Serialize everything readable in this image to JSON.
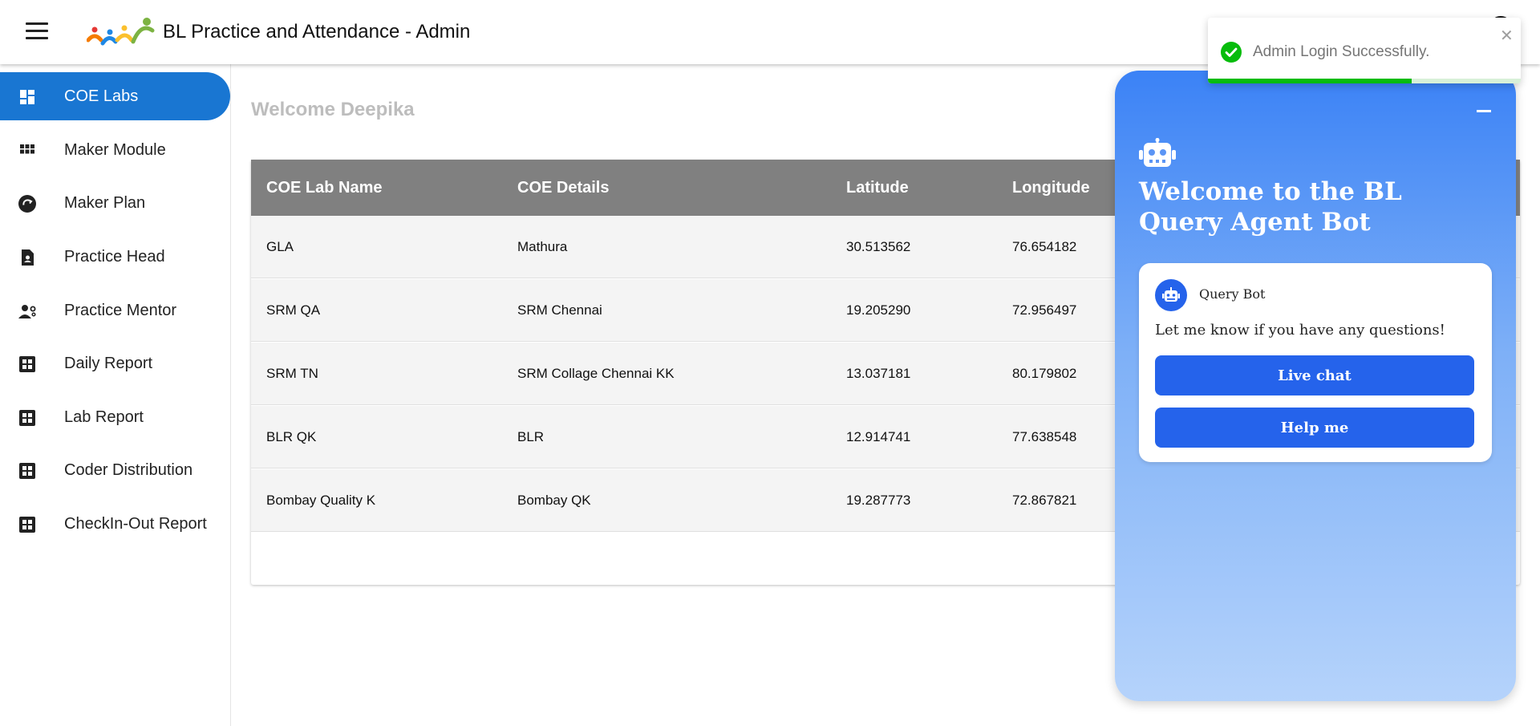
{
  "header": {
    "menu_icon": "hamburger-menu-icon",
    "logo": "people-logo",
    "title": "BL Practice and Attendance - Admin"
  },
  "sidebar": {
    "items": [
      {
        "label": "COE Labs",
        "icon": "dashboard-icon",
        "active": true
      },
      {
        "label": "Maker Module",
        "icon": "grid-icon",
        "active": false
      },
      {
        "label": "Maker Plan",
        "icon": "refresh-circle-icon",
        "active": false
      },
      {
        "label": "Practice Head",
        "icon": "contact-document-icon",
        "active": false
      },
      {
        "label": "Practice Mentor",
        "icon": "person-gear-icon",
        "active": false
      },
      {
        "label": "Daily Report",
        "icon": "apps-box-icon",
        "active": false
      },
      {
        "label": "Lab Report",
        "icon": "apps-box-icon",
        "active": false
      },
      {
        "label": "Coder Distribution",
        "icon": "apps-box-icon",
        "active": false
      },
      {
        "label": "CheckIn-Out Report",
        "icon": "apps-box-icon",
        "active": false
      }
    ],
    "active_color": "#1976d2"
  },
  "main": {
    "welcome": "Welcome Deepika",
    "table": {
      "columns": [
        "COE Lab Name",
        "COE Details",
        "Latitude",
        "Longitude"
      ],
      "rows": [
        [
          "GLA",
          "Mathura",
          "30.513562",
          "76.654182"
        ],
        [
          "SRM QA",
          "SRM Chennai",
          "19.205290",
          "72.956497"
        ],
        [
          "SRM TN",
          "SRM Collage Chennai KK",
          "13.037181",
          "80.179802"
        ],
        [
          "BLR QK",
          "BLR",
          "12.914741",
          "77.638548"
        ],
        [
          "Bombay Quality K",
          "Bombay QK",
          "19.287773",
          "72.867821"
        ]
      ],
      "header_color": "#808080"
    }
  },
  "chat": {
    "minimize_icon": "minimize-icon",
    "bot_icon": "robot-icon",
    "title": "Welcome to the BL Query Agent Bot",
    "bot_name": "Query Bot",
    "message": "Let me know if you have any questions!",
    "buttons": [
      "Live chat",
      "Help me"
    ],
    "button_color": "#2563eb"
  },
  "toast": {
    "icon": "check-circle-icon",
    "message": "Admin Login Successfully.",
    "close_icon": "close-icon",
    "progress": 0.65,
    "color": "#07bc0c"
  }
}
